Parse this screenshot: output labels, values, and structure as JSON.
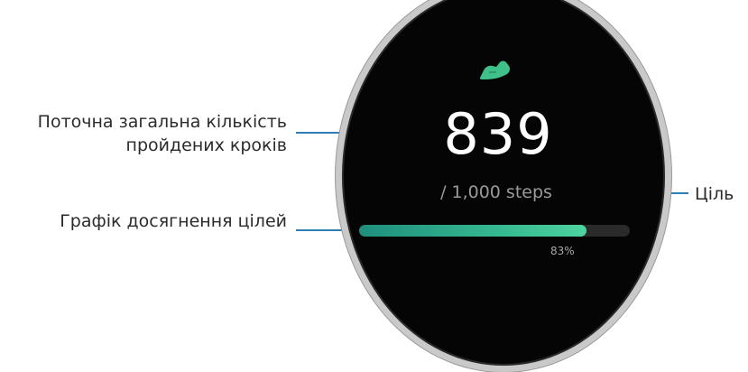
{
  "annotations": {
    "current_steps": [
      "Поточна загальна кількість",
      "пройдених кроків"
    ],
    "goal": "Ціль",
    "graph": "Графік досягнення цілей"
  },
  "watch": {
    "icon": "running-shoe-icon",
    "accent_color": "#3fbf8a",
    "steps_count": "839",
    "goal_text": "/ 1,000 steps",
    "progress": 0.839,
    "percent_text": "83%"
  }
}
